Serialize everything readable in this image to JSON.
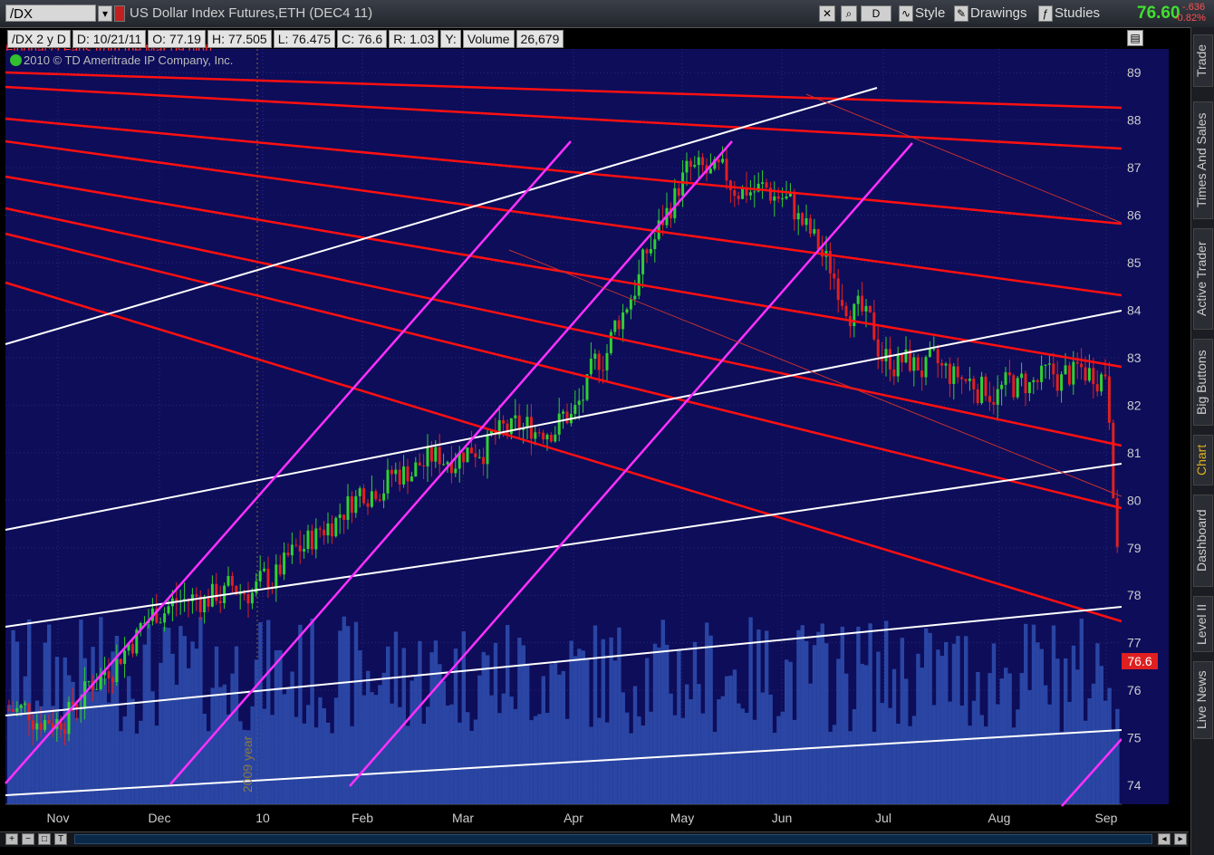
{
  "toolbar": {
    "symbol": "/DX",
    "description": "US Dollar Index Futures,ETH (DEC4 11)",
    "period_btn": "D",
    "style_label": "Style",
    "drawings_label": "Drawings",
    "studies_label": "Studies",
    "last_price": "76.60",
    "change_abs": "-.636",
    "change_pct": "-0.82%"
  },
  "info": {
    "symbol_period": "/DX 2 y D",
    "date": "D: 10/21/11",
    "open": "O: 77.19",
    "high": "H: 77.505",
    "low": "L: 76.475",
    "close": "C: 76.6",
    "range": "R: 1.03",
    "y": "Y:",
    "volume_label": "Volume",
    "volume_value": "26,679",
    "study_text": "Fibonacci Fans from the Mar 09 high",
    "copyright": "2010 © TD Ameritrade IP Company, Inc.",
    "annotation": "2009 year"
  },
  "price_tag": "76.6",
  "side_tabs": [
    "Trade",
    "Times And Sales",
    "Active Trader",
    "Big Buttons",
    "Chart",
    "Dashboard",
    "Level II",
    "Live News"
  ],
  "active_tab": "Chart",
  "colors": {
    "background": "#0d0d5a",
    "up_candle": "#30d030",
    "down_candle": "#e02020",
    "fan_lines": "#ff1010",
    "channel_lines": "#ff30ff",
    "trend_lines": "#ffffff",
    "volume": "#3050b0"
  },
  "chart_data": {
    "type": "candlestick",
    "title": "US Dollar Index Futures,ETH (DEC4 11)",
    "xlabel": "",
    "ylabel": "",
    "x_ticks": [
      "Nov",
      "Dec",
      "10",
      "Feb",
      "Mar",
      "Apr",
      "May",
      "Jun",
      "Jul",
      "Aug",
      "Sep"
    ],
    "y_ticks": [
      74,
      75,
      76,
      77,
      78,
      79,
      80,
      81,
      82,
      83,
      84,
      85,
      86,
      87,
      88,
      89
    ],
    "ylim": [
      73.6,
      89.5
    ],
    "grid": true,
    "monthly_close_approx": [
      {
        "month": "Nov",
        "close": 75.4
      },
      {
        "month": "Dec",
        "close": 77.8
      },
      {
        "month": "10",
        "close": 78.2
      },
      {
        "month": "Feb",
        "close": 80.3
      },
      {
        "month": "Mar",
        "close": 81.1
      },
      {
        "month": "Apr",
        "close": 81.8
      },
      {
        "month": "May",
        "close": 86.9
      },
      {
        "month": "Jun",
        "close": 86.4
      },
      {
        "month": "Jul",
        "close": 83.0
      },
      {
        "month": "Aug",
        "close": 82.3
      },
      {
        "month": "Sep",
        "close": 82.8
      }
    ],
    "last": 76.6
  }
}
